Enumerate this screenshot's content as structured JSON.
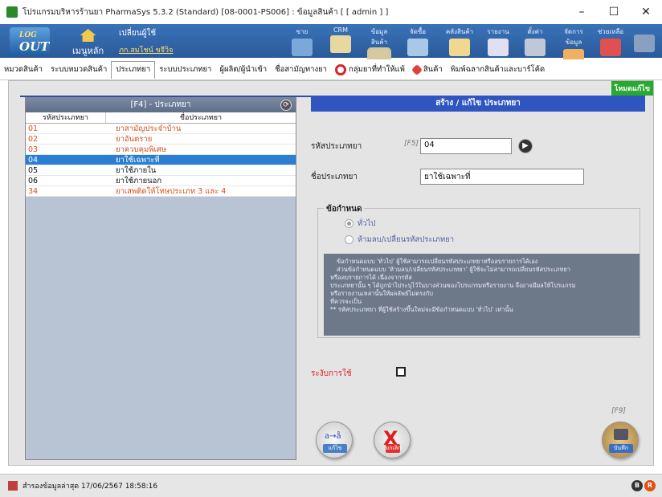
{
  "window": {
    "title": "โปรแกรมบริหารร้านยา PharmaSys 5.3.2 (Standard) [08-0001-PS006] : ข้อมูลสินค้า [ [ admin ] ]",
    "minimize": "–",
    "maximize": "☐",
    "close": "✕"
  },
  "toolbar": {
    "logout_top": "LOG",
    "logout_main": "OUT",
    "home_label": "เมนูหลัก",
    "change_user": "เปลี่ยนผู้ใช้",
    "user_name": "ภก.สมโชน์ ขจีวิจ",
    "items": [
      {
        "label": "ขาย",
        "color": "#7aa8d8"
      },
      {
        "label": "CRM",
        "color": "#e8d8a0"
      },
      {
        "label": "ข้อมูลสินค้า",
        "color": "#d8c8a0"
      },
      {
        "label": "จัดซื้อ",
        "color": "#a8c8e8"
      },
      {
        "label": "คลังสินค้า",
        "color": "#f0d890"
      },
      {
        "label": "รายงาน",
        "color": "#e0e0f0"
      },
      {
        "label": "ตั้งค่า",
        "color": "#c0c8d8"
      },
      {
        "label": "จัดการข้อมูล",
        "color": "#f0b060"
      },
      {
        "label": "ช่วยเหลือ",
        "color": "#e05050"
      },
      {
        "label": "",
        "color": "#8aa0c0"
      }
    ]
  },
  "tabs": [
    "หมวดสินค้า",
    "ระบบหมวดสินค้า",
    "ประเภทยา",
    "ระบบประเภทยา",
    "ผู้ผลิต/ผู้นำเข้า",
    "ชื่อสามัญทางยา",
    "กลุ่มยาที่ทำให้แพ้",
    "สินค้า",
    "พิมพ์ฉลากสินค้าและบาร์โค้ด"
  ],
  "mode_badge": "โหมดแก้ไข",
  "list": {
    "title": "[F4] - ประเภทยา",
    "col_code": "รหัสประเภทยา",
    "col_name": "ชื่อประเภทยา",
    "rows": [
      {
        "code": "01",
        "name": "ยาสามัญประจำบ้าน",
        "style": "red"
      },
      {
        "code": "02",
        "name": "ยาอันตราย",
        "style": "red"
      },
      {
        "code": "03",
        "name": "ยาควบคุมพิเศษ",
        "style": "red"
      },
      {
        "code": "04",
        "name": "ยาใช้เฉพาะที่",
        "style": "selected"
      },
      {
        "code": "05",
        "name": "ยาใช้ภายใน",
        "style": "black"
      },
      {
        "code": "06",
        "name": "ยาใช้ภายนอก",
        "style": "black"
      },
      {
        "code": "34",
        "name": "ยาเสพติดให้โทษประเภท 3 และ 4",
        "style": "red"
      }
    ]
  },
  "form": {
    "header": "สร้าง / แก้ไข ประเภทยา",
    "code_label": "รหัสประเภทยา",
    "code_hint": "[F5]",
    "code_value": "04",
    "name_label": "ชื่อประเภทยา",
    "name_value": "ยาใช้เฉพาะที่",
    "cond_title": "ข้อกำหนด",
    "radio_general": "ทั่วไป",
    "radio_restrict": "ห้ามลบ/เปลี่ยนรหัสประเภทยา",
    "note_lines": [
      "ข้อกำหนดแบบ 'ทั่วไป' ผู้ใช้สามารถเปลี่ยนรหัสประเภทยาหรือลบรายการได้เอง",
      "ส่วนข้อกำหนดแบบ 'ห้ามลบ/เปลี่ยนรหัสประเภทยา' ผู้ใช้จะไม่สามารถเปลี่ยนรหัสประเภทยา",
      "หรือลบรายการได้ เนื่องจากรหัส",
      "ประเภทยานั้น ๆ ได้ถูกนำไประบุไว้ในบางส่วนของโปรแกรมหรือรายงาน จึงอาจมีผลให้โปรแกรม",
      "หรือรายงานเหล่านั้นให้ผลลัพธ์ไม่ตรงกับ",
      "ที่ควรจะเป็น",
      "** รหัสประเภทยา ที่ผู้ใช้สร้างขึ้นใหม่จะมีข้อกำหนดแบบ 'ทั่วไป' เท่านั้น"
    ],
    "cancel_use_label": "ระงับการใช้",
    "edit_btn": "แก้ไข",
    "cancel_btn": "ยกเลิก",
    "save_hint": "[F9]",
    "save_btn": "บันทึก"
  },
  "status": {
    "text": "สำรองข้อมูลล่าสุด  17/06/2567 18:58:16"
  }
}
